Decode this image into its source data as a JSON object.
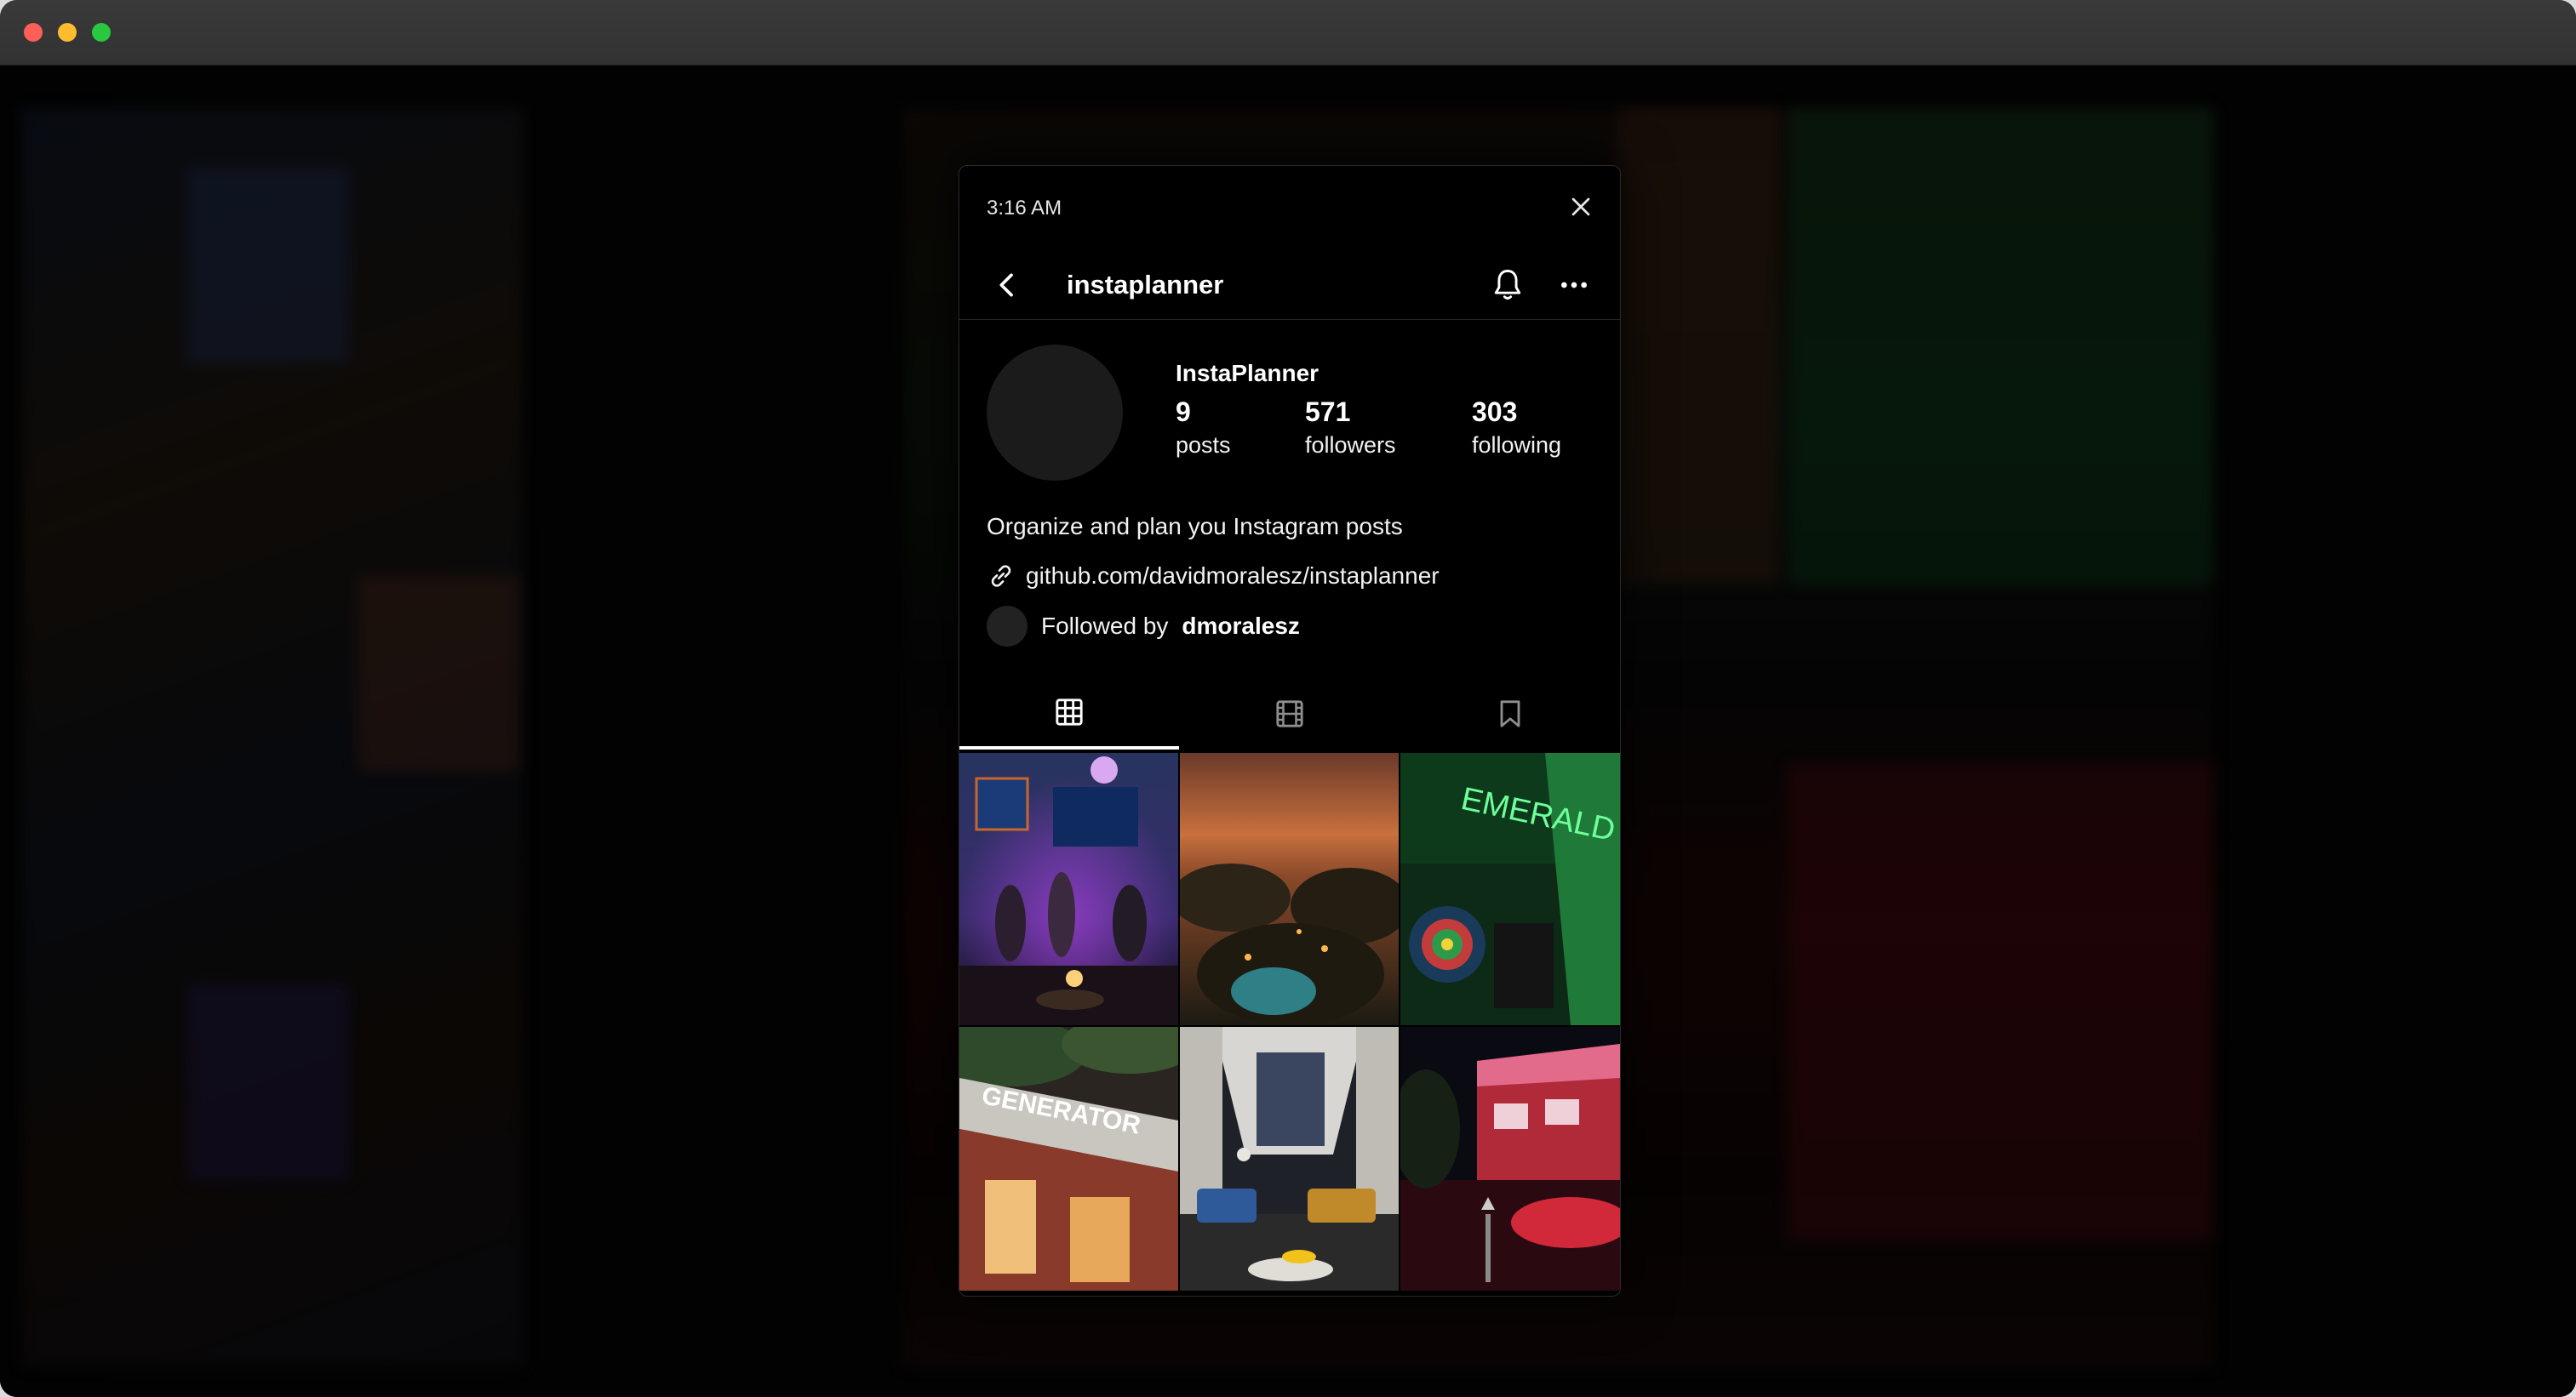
{
  "status_bar": {
    "time": "3:16 AM"
  },
  "nav": {
    "username": "instaplanner"
  },
  "profile": {
    "display_name": "InstaPlanner",
    "stats": [
      {
        "value": "9",
        "label": "posts"
      },
      {
        "value": "571",
        "label": "followers"
      },
      {
        "value": "303",
        "label": "following"
      }
    ],
    "bio": "Organize and plan you Instagram posts",
    "link": "github.com/davidmoralesz/instaplanner",
    "followed_by_prefix": "Followed by",
    "followed_by_user": "dmoralesz"
  },
  "tabs": [
    {
      "name": "posts-grid",
      "icon": "grid-icon",
      "active": true
    },
    {
      "name": "reels",
      "icon": "film-icon",
      "active": false
    },
    {
      "name": "saved",
      "icon": "bookmark-icon",
      "active": false
    }
  ],
  "posts": [
    {
      "subject": "live band on stage"
    },
    {
      "subject": "sunset palm trees pool"
    },
    {
      "subject": "neon sign",
      "sign_text": "EMERALD"
    },
    {
      "subject": "hotel facade",
      "sign_text": "GENERATOR"
    },
    {
      "subject": "lobby lounge interior"
    },
    {
      "subject": "red neon building at night"
    }
  ],
  "colors": {
    "modal_bg": "#000000",
    "divider": "#262626",
    "accent_text": "#ffffff",
    "neon_green": "#3fe57a"
  }
}
